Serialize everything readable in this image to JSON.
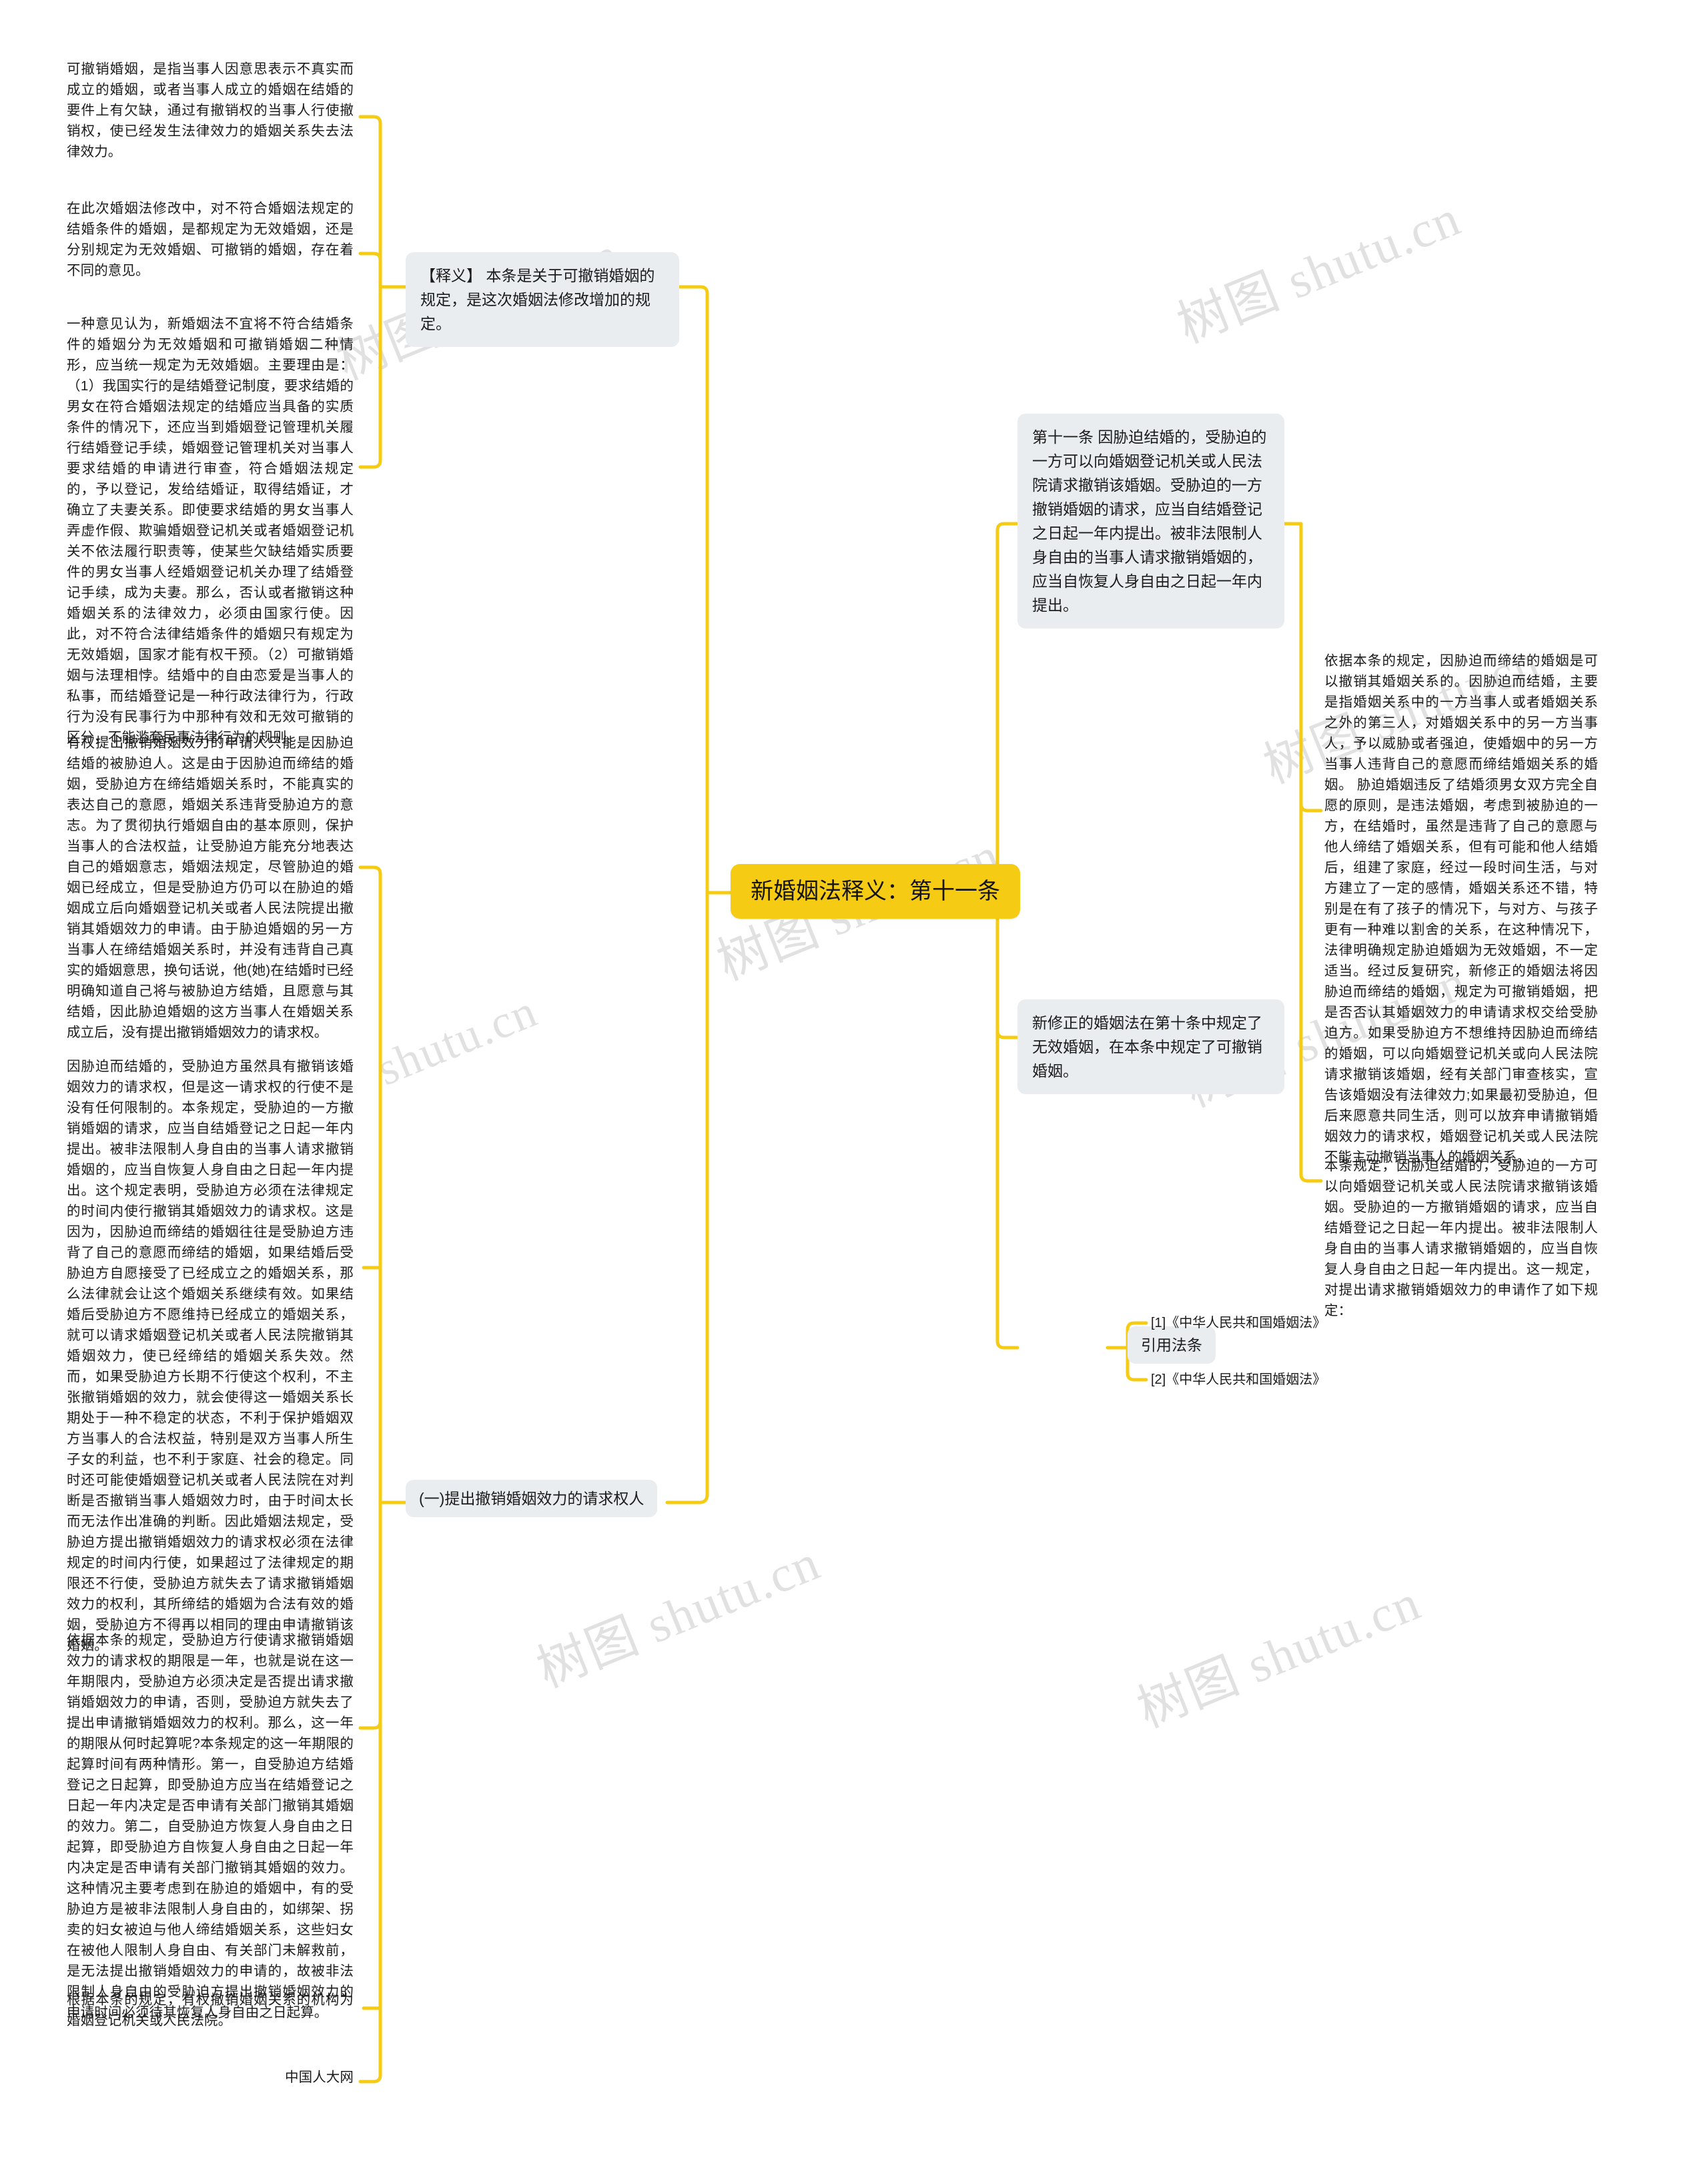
{
  "meta": {
    "accent_color": "#f5cc13",
    "node_bg": "#e9edf0",
    "page_bg": "#ffffff",
    "watermark_text_cn": "树图 shutu.cn",
    "watermark_text_en": "shutu.cn"
  },
  "root": {
    "label": "新婚姻法释义：第十一条"
  },
  "left_branch": {
    "释义_node": "【释义】 本条是关于可撤销婚姻的规定，是这次婚姻法修改增加的规定。",
    "释义_children": [
      "可撤销婚姻，是指当事人因意思表示不真实而成立的婚姻，或者当事人成立的婚姻在结婚的要件上有欠缺，通过有撤销权的当事人行使撤销权，使已经发生法律效力的婚姻关系失去法律效力。",
      "在此次婚姻法修改中，对不符合婚姻法规定的结婚条件的婚姻，是都规定为无效婚姻，还是分别规定为无效婚姻、可撤销的婚姻，存在着不同的意见。",
      "一种意见认为，新婚姻法不宜将不符合结婚条件的婚姻分为无效婚姻和可撤销婚姻二种情形，应当统一规定为无效婚姻。主要理由是：（1）我国实行的是结婚登记制度，要求结婚的男女在符合婚姻法规定的结婚应当具备的实质条件的情况下，还应当到婚姻登记管理机关履行结婚登记手续，婚姻登记管理机关对当事人要求结婚的申请进行审查，符合婚姻法规定的，予以登记，发给结婚证，取得结婚证，才确立了夫妻关系。即使要求结婚的男女当事人弄虚作假、欺骗婚姻登记机关或者婚姻登记机关不依法履行职责等，使某些欠缺结婚实质要件的男女当事人经婚姻登记机关办理了结婚登记手续，成为夫妻。那么，否认或者撤销这种婚姻关系的法律效力，必须由国家行使。因此，对不符合法律结婚条件的婚姻只有规定为无效婚姻，国家才能有权干预。（2）可撤销婚姻与法理相悖。结婚中的自由恋爱是当事人的私事，而结婚登记是一种行政法律行为，行政行为没有民事行为中那种有效和无效可撤销的区分，不能滥套民事法律行为的规则。"
    ],
    "请求权人_node": "(一)提出撤销婚姻效力的请求权人",
    "请求权人_children": [
      "有权提出撤销婚姻效力的申请人只能是因胁迫结婚的被胁迫人。这是由于因胁迫而缔结的婚姻，受胁迫方在缔结婚姻关系时，不能真实的表达自己的意愿，婚姻关系违背受胁迫方的意志。为了贯彻执行婚姻自由的基本原则，保护当事人的合法权益，让受胁迫方能充分地表达自己的婚姻意志，婚姻法规定，尽管胁迫的婚姻已经成立，但是受胁迫方仍可以在胁迫的婚姻成立后向婚姻登记机关或者人民法院提出撤销其婚姻效力的申请。由于胁迫婚姻的另一方当事人在缔结婚姻关系时，并没有违背自己真实的婚姻意思，换句话说，他(她)在结婚时已经明确知道自己将与被胁迫方结婚，且愿意与其结婚，因此胁迫婚姻的这方当事人在婚姻关系成立后，没有提出撤销婚姻效力的请求权。",
      "因胁迫而结婚的，受胁迫方虽然具有撤销该婚姻效力的请求权，但是这一请求权的行使不是没有任何限制的。本条规定，受胁迫的一方撤销婚姻的请求，应当自结婚登记之日起一年内提出。被非法限制人身自由的当事人请求撤销婚姻的，应当自恢复人身自由之日起一年内提出。这个规定表明，受胁迫方必须在法律规定的时间内使行撤销其婚姻效力的请求权。这是因为，因胁迫而缔结的婚姻往往是受胁迫方违背了自己的意愿而缔结的婚姻，如果结婚后受胁迫方自愿接受了已经成立之的婚姻关系，那么法律就会让这个婚姻关系继续有效。如果结婚后受胁迫方不愿维持已经成立的婚姻关系，就可以请求婚姻登记机关或者人民法院撤销其婚姻效力，使已经缔结的婚姻关系失效。然而，如果受胁迫方长期不行使这个权利，不主张撤销婚姻的效力，就会使得这一婚姻关系长期处于一种不稳定的状态，不利于保护婚姻双方当事人的合法权益，特别是双方当事人所生子女的利益，也不利于家庭、社会的稳定。同时还可能使婚姻登记机关或者人民法院在对判断是否撤销当事人婚姻效力时，由于时间太长而无法作出准确的判断。因此婚姻法规定，受胁迫方提出撤销婚姻效力的请求权必须在法律规定的时间内行使，如果超过了法律规定的期限还不行使，受胁迫方就失去了请求撤销婚姻效力的权利，其所缔结的婚姻为合法有效的婚姻，受胁迫方不得再以相同的理由申请撤销该婚姻。",
      "依据本条的规定，受胁迫方行使请求撤销婚姻效力的请求权的期限是一年，也就是说在这一年期限内，受胁迫方必须决定是否提出请求撤销婚姻效力的申请，否则，受胁迫方就失去了提出申请撤销婚姻效力的权利。那么，这一年的期限从何时起算呢?本条规定的这一年期限的起算时间有两种情形。第一，自受胁迫方结婚登记之日起算，即受胁迫方应当在结婚登记之日起一年内决定是否申请有关部门撤销其婚姻的效力。第二，自受胁迫方恢复人身自由之日起算，即受胁迫方自恢复人身自由之日起一年内决定是否申请有关部门撤销其婚姻的效力。这种情况主要考虑到在胁迫的婚姻中，有的受胁迫方是被非法限制人身自由的，如绑架、拐卖的妇女被迫与他人缔结婚姻关系，这些妇女在被他人限制人身自由、有关部门未解救前，是无法提出撤销婚姻效力的申请的，故被非法限制人身自由的受胁迫方提出撤销婚姻效力的申请时间必须待其恢复人身自由之日起算。",
      "根据本条的规定，有权撤销婚姻关系的机构为婚姻登记机关或人民法院。",
      "中国人大网"
    ]
  },
  "right_branch": {
    "article_node": "第十一条 因胁迫结婚的，受胁迫的一方可以向婚姻登记机关或人民法院请求撤销该婚姻。受胁迫的一方撤销婚姻的请求，应当自结婚登记之日起一年内提出。被非法限制人身自由的当事人请求撤销婚姻的，应当自恢复人身自由之日起一年内提出。",
    "article_children": [
      "依据本条的规定，因胁迫而缔结的婚姻是可以撤销其婚姻关系的。因胁迫而结婚，主要是指婚姻关系中的一方当事人或者婚姻关系之外的第三人，对婚姻关系中的另一方当事人，予以威胁或者强迫，使婚姻中的另一方当事人违背自己的意愿而缔结婚姻关系的婚姻。 胁迫婚姻违反了结婚须男女双方完全自愿的原则，是违法婚姻，考虑到被胁迫的一方，在结婚时，虽然是违背了自己的意愿与他人缔结了婚姻关系，但有可能和他人结婚后，组建了家庭，经过一段时间生活，与对方建立了一定的感情，婚姻关系还不错，特别是在有了孩子的情况下，与对方、与孩子更有一种难以割舍的关系，在这种情况下，法律明确规定胁迫婚姻为无效婚姻，不一定适当。经过反复研究，新修正的婚姻法将因胁迫而缔结的婚姻，规定为可撤销婚姻，把是否否认其婚姻效力的申请请求权交给受胁迫方。如果受胁迫方不想维持因胁迫而缔结的婚姻，可以向婚姻登记机关或向人民法院请求撤销该婚姻，经有关部门审查核实，宣告该婚姻没有法律效力;如果最初受胁迫，但后来愿意共同生活，则可以放弃申请撤销婚姻效力的请求权，婚姻登记机关或人民法院不能主动撤销当事人的婚姻关系。",
      "本条规定，因胁迫结婚的，受胁迫的一方可以向婚姻登记机关或人民法院请求撤销该婚姻。受胁迫的一方撤销婚姻的请求，应当自结婚登记之日起一年内提出。被非法限制人身自由的当事人请求撤销婚姻的，应当自恢复人身自由之日起一年内提出。这一规定，对提出请求撤销婚姻效力的申请作了如下规定："
    ],
    "amend_node": "新修正的婚姻法在第十条中规定了无效婚姻，在本条中规定了可撤销婚姻。",
    "cite_node": "引用法条",
    "citations": [
      "[1]《中华人民共和国婚姻法》",
      "[2]《中华人民共和国婚姻法》"
    ]
  }
}
